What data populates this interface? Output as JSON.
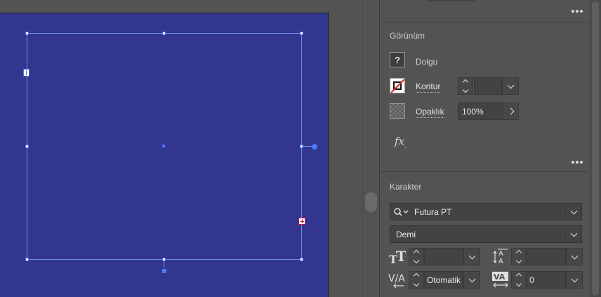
{
  "appearance": {
    "title": "Görünüm",
    "fill_label": "Dolgu",
    "stroke_label": "Kontur",
    "stroke_weight": "",
    "opacity_label": "Opaklık",
    "opacity_value": "100%",
    "fx_label": "fx"
  },
  "character": {
    "title": "Karakter",
    "font_family": "Futura PT",
    "font_style": "Demi",
    "font_size": "",
    "leading": "",
    "kerning": "Otomatik",
    "tracking": "0"
  },
  "icons": {
    "fill": "question-mark-icon",
    "stroke": "no-stroke-icon",
    "opacity": "checkerboard-icon",
    "effects": "fx-icon",
    "search": "search-icon",
    "font_size": "font-size-icon",
    "leading": "leading-icon",
    "kerning": "kerning-icon",
    "tracking": "tracking-icon"
  },
  "colors": {
    "artboard": "#33368e",
    "selection": "#6e8cf0",
    "panel_bg": "#535353",
    "stroke_slash": "#e01e2e"
  }
}
